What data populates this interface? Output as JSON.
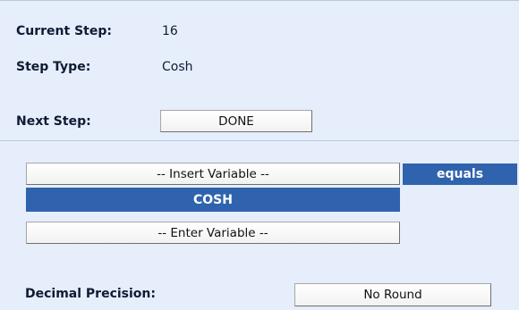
{
  "header": {
    "current_step_label": "Current Step:",
    "current_step_value": "16",
    "step_type_label": "Step Type:",
    "step_type_value": "Cosh",
    "next_step_label": "Next Step:",
    "next_step_button": "DONE"
  },
  "editor": {
    "insert_variable_button": "-- Insert Variable --",
    "equals_label": "equals",
    "function_label": "COSH",
    "enter_variable_button": "-- Enter Variable --"
  },
  "footer": {
    "decimal_precision_label": "Decimal Precision:",
    "decimal_precision_value": "No Round"
  },
  "colors": {
    "panel_bg": "#e6eefb",
    "accent_blue": "#2f63ad"
  }
}
